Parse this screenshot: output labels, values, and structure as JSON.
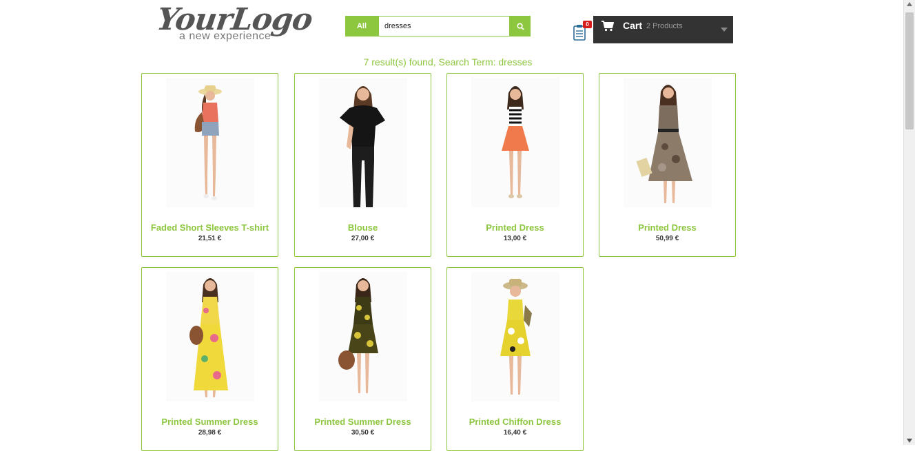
{
  "header": {
    "logo_main": "YourLogo",
    "logo_sub": "a new experience",
    "search": {
      "category": "All",
      "value": "dresses"
    },
    "compare_count": "0",
    "cart": {
      "label": "Cart",
      "count": "2 Products"
    }
  },
  "results_text": "7 result(s) found, Search Term: dresses",
  "products": [
    {
      "name": "Faded Short Sleeves T-shirt",
      "price": "21,51 €"
    },
    {
      "name": "Blouse",
      "price": "27,00 €"
    },
    {
      "name": "Printed Dress",
      "price": "13,00 €"
    },
    {
      "name": "Printed Dress",
      "price": "50,99 €"
    },
    {
      "name": "Printed Summer Dress",
      "price": "28,98 €"
    },
    {
      "name": "Printed Summer Dress",
      "price": "30,50 €"
    },
    {
      "name": "Printed Chiffon Dress",
      "price": "16,40 €"
    }
  ],
  "colors": {
    "accent": "#8dc63f",
    "cart_bg": "#333333",
    "badge": "#d81c1c"
  },
  "icons": {
    "search": "search-icon",
    "cart": "shopping-cart-icon",
    "compare": "clipboard-icon",
    "dropdown": "caret-down-icon"
  }
}
